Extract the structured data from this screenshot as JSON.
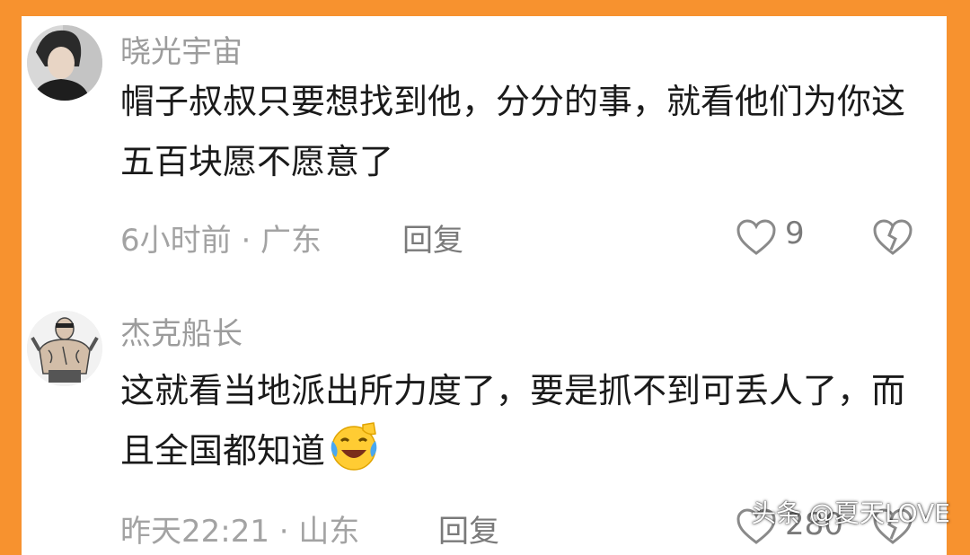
{
  "comments": [
    {
      "username": "晓光宇宙",
      "text": "帽子叔叔只要想找到他，分分的事，就看他们为你这五百块愿不愿意了",
      "meta": "6小时前 · 广东",
      "reply_label": "回复",
      "likes": "9",
      "avatar_icon": "avatar-photo-icon"
    },
    {
      "username": "杰克船长",
      "text": "这就看当地派出所力度了，要是抓不到可丢人了，而且全国都知道",
      "emoji": "laughing-crying-emoji",
      "meta": "昨天22:21 · 山东",
      "reply_label": "回复",
      "likes": "280",
      "avatar_icon": "avatar-tattooed-man-icon"
    }
  ],
  "watermark": "头条 @夏天LOVE",
  "colors": {
    "frame": "#f7922f",
    "text_primary": "#1a1a1a",
    "text_secondary": "#9c9c9c"
  }
}
